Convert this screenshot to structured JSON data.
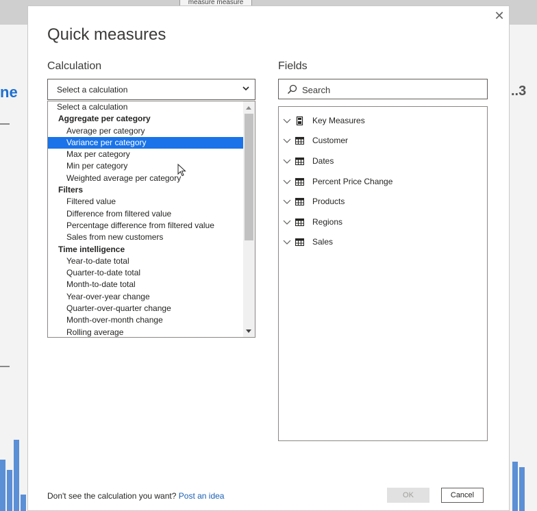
{
  "background": {
    "top_tab_text": "measure measure",
    "left_partial_text": "ne",
    "right_partial_text": "..3"
  },
  "dialog": {
    "title": "Quick measures",
    "close_glyph": "✕",
    "calculation_label": "Calculation",
    "fields_label": "Fields",
    "calculation_select_value": "Select a calculation",
    "search_placeholder": "Search",
    "dropdown": {
      "items": [
        {
          "type": "item",
          "label": "Select a calculation",
          "first": true
        },
        {
          "type": "group",
          "label": "Aggregate per category"
        },
        {
          "type": "item",
          "label": "Average per category"
        },
        {
          "type": "item",
          "label": "Variance per category",
          "selected": true
        },
        {
          "type": "item",
          "label": "Max per category"
        },
        {
          "type": "item",
          "label": "Min per category"
        },
        {
          "type": "item",
          "label": "Weighted average per category"
        },
        {
          "type": "group",
          "label": "Filters"
        },
        {
          "type": "item",
          "label": "Filtered value"
        },
        {
          "type": "item",
          "label": "Difference from filtered value"
        },
        {
          "type": "item",
          "label": "Percentage difference from filtered value"
        },
        {
          "type": "item",
          "label": "Sales from new customers"
        },
        {
          "type": "group",
          "label": "Time intelligence"
        },
        {
          "type": "item",
          "label": "Year-to-date total"
        },
        {
          "type": "item",
          "label": "Quarter-to-date total"
        },
        {
          "type": "item",
          "label": "Month-to-date total"
        },
        {
          "type": "item",
          "label": "Year-over-year change"
        },
        {
          "type": "item",
          "label": "Quarter-over-quarter change"
        },
        {
          "type": "item",
          "label": "Month-over-month change"
        },
        {
          "type": "item",
          "label": "Rolling average"
        }
      ]
    },
    "fields": [
      {
        "label": "Key Measures",
        "icon": "calculator-icon"
      },
      {
        "label": "Customer",
        "icon": "table-icon"
      },
      {
        "label": "Dates",
        "icon": "table-icon"
      },
      {
        "label": "Percent Price Change",
        "icon": "table-icon"
      },
      {
        "label": "Products",
        "icon": "table-icon"
      },
      {
        "label": "Regions",
        "icon": "table-icon"
      },
      {
        "label": "Sales",
        "icon": "table-icon"
      }
    ],
    "footer": {
      "prompt": "Don't see the calculation you want?",
      "link": "Post an idea"
    },
    "ok_label": "OK",
    "cancel_label": "Cancel"
  },
  "colors": {
    "selection": "#1a73e8",
    "link": "#1a5fb4",
    "bg_chart_bars": "#5b8fd6"
  }
}
